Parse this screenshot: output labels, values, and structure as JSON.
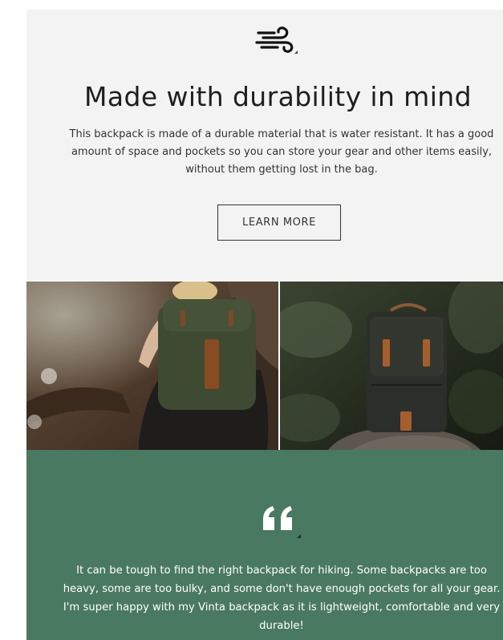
{
  "hero": {
    "icon": "wind-icon",
    "headline": "Made with durability in mind",
    "body": "This backpack is made of a durable material that is water resistant. It has a good amount of space and pockets so you can store your gear and other items easily, without them getting lost in the bag.",
    "button_label": "LEARN MORE"
  },
  "gallery": {
    "images": [
      "hiker-wearing-backpack-photo",
      "backpack-on-rock-photo"
    ]
  },
  "testimonial": {
    "icon": "quote-icon",
    "quote": "It can be tough to find the right backpack for hiking. Some backpacks are too heavy, some are too bulky, and some don't have enough pockets for all your gear. I'm super happy with my Vinta backpack as it is lightweight, comfortable and very durable!"
  },
  "colors": {
    "hero_background": "#f3f3f3",
    "testimonial_background": "#4a7961",
    "text_dark": "#1e1e1e",
    "text_light": "#ffffff"
  }
}
